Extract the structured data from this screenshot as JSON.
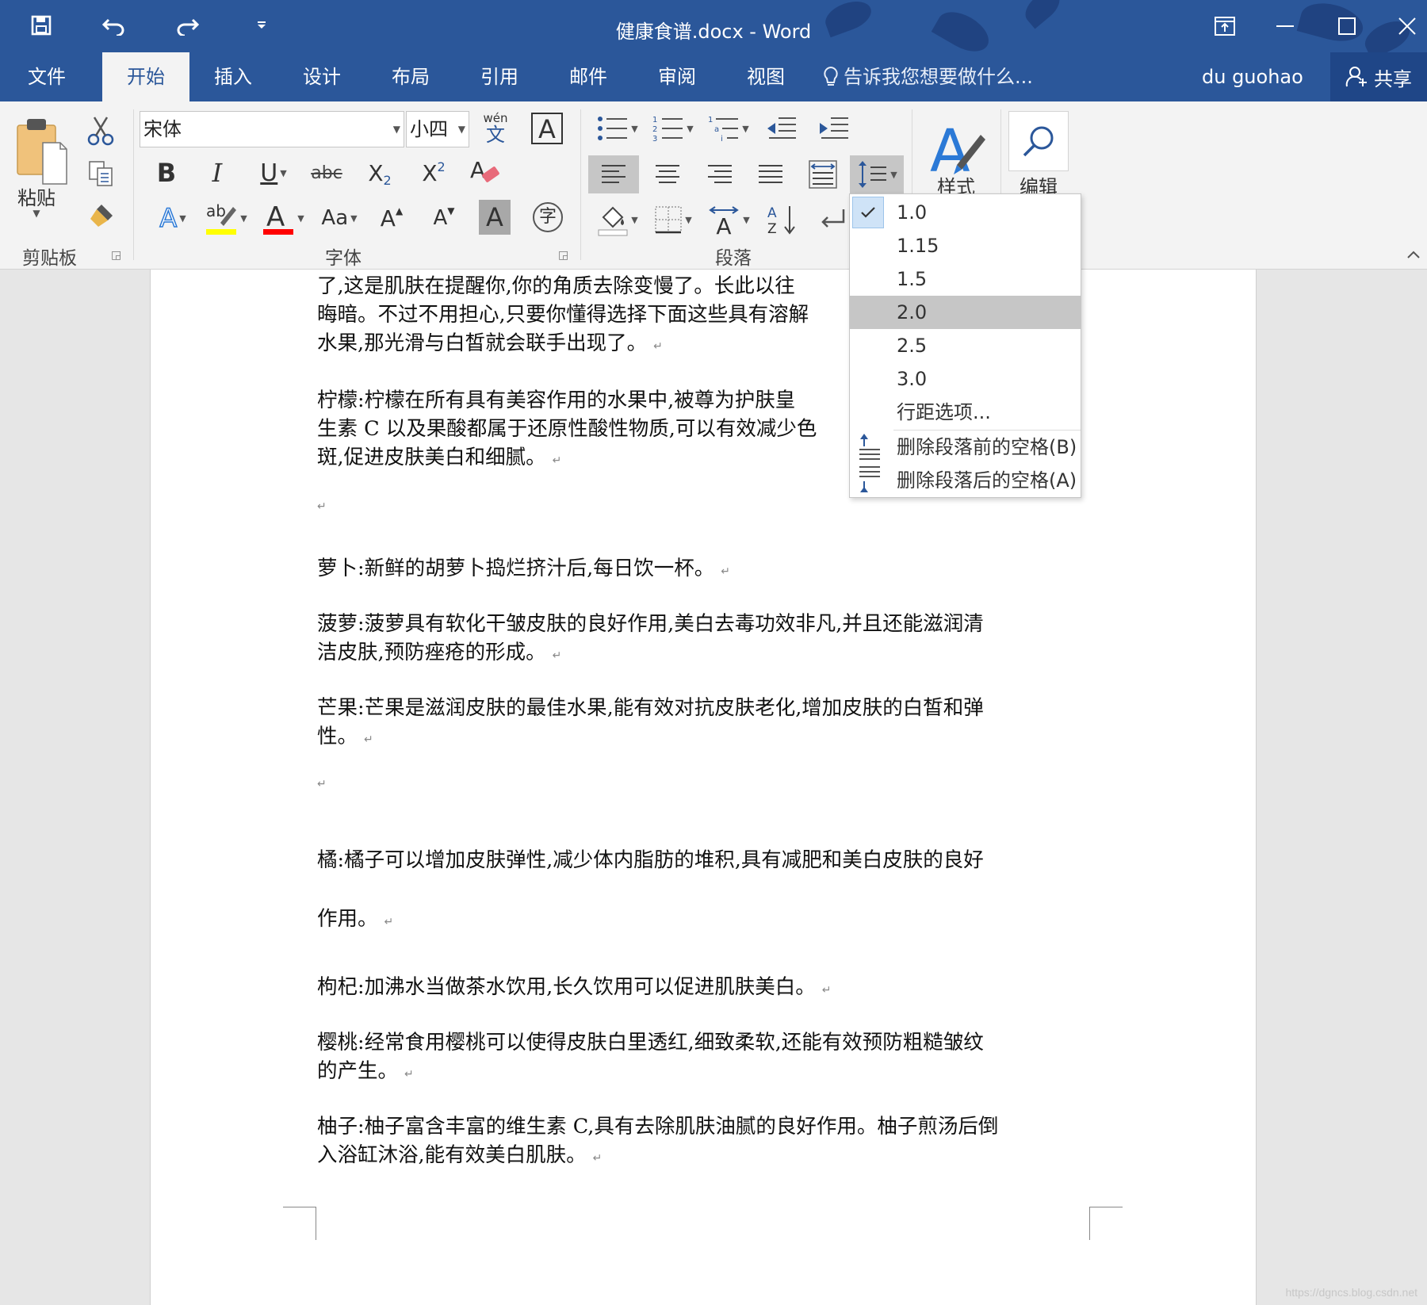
{
  "window": {
    "title": "健康食谱.docx - Word"
  },
  "tabs": [
    "文件",
    "开始",
    "插入",
    "设计",
    "布局",
    "引用",
    "邮件",
    "审阅",
    "视图"
  ],
  "tell_me": "告诉我您想要做什么...",
  "user": "du guohao",
  "share": "共享",
  "ribbon": {
    "clipboard": {
      "paste": "粘贴",
      "label": "剪贴板"
    },
    "font": {
      "name": "宋体",
      "size": "小四",
      "label": "字体",
      "phonetic_top": "wén",
      "phonetic_bottom": "文",
      "enclose_char": "字",
      "change_case": "Aa",
      "grow_font": "A",
      "shrink_font": "A"
    },
    "paragraph": {
      "label": "段落"
    },
    "styles": {
      "label": "样式"
    },
    "editing": {
      "label": "编辑"
    }
  },
  "line_spacing_menu": {
    "items": [
      "1.0",
      "1.15",
      "1.5",
      "2.0",
      "2.5",
      "3.0"
    ],
    "checked": "1.0",
    "highlighted": "2.0",
    "options": "行距选项...",
    "remove_before": "删除段落前的空格(B)",
    "remove_after": "删除段落后的空格(A)"
  },
  "document": {
    "paragraphs": [
      "了,这是肌肤在提醒你,你的角质去除变慢了。长此以往",
      "晦暗。不过不用担心,只要你懂得选择下面这些具有溶解",
      "水果,那光滑与白皙就会联手出现了。",
      "柠檬:柠檬在所有具有美容作用的水果中,被尊为护肤皇",
      "生素 C 以及果酸都属于还原性酸性物质,可以有效减少色",
      "斑,促进皮肤美白和细腻。",
      "萝卜:新鲜的胡萝卜捣烂挤汁后,每日饮一杯。",
      "菠萝:菠萝具有软化干皱皮肤的良好作用,美白去毒功效非凡,并且还能滋润清",
      "洁皮肤,预防痤疮的形成。",
      "芒果:芒果是滋润皮肤的最佳水果,能有效对抗皮肤老化,增加皮肤的白皙和弹",
      "性。",
      "橘:橘子可以增加皮肤弹性,减少体内脂肪的堆积,具有减肥和美白皮肤的良好",
      "作用。",
      "枸杞:加沸水当做茶水饮用,长久饮用可以促进肌肤美白。",
      "樱桃:经常食用樱桃可以使得皮肤白里透红,细致柔软,还能有效预防粗糙皱纹",
      "的产生。",
      "柚子:柚子富含丰富的维生素 C,具有去除肌肤油腻的良好作用。柚子煎汤后倒",
      "入浴缸沐浴,能有效美白肌肤。"
    ],
    "paragraph_mark": "↵"
  },
  "watermark": "https://dgncs.blog.csdn.net",
  "colors": {
    "title_bar": "#2b579a",
    "ribbon": "#f3f3f3",
    "highlight_yellow": "#ffff00",
    "font_red": "#ff0000",
    "accent_blue": "#2b579a"
  }
}
